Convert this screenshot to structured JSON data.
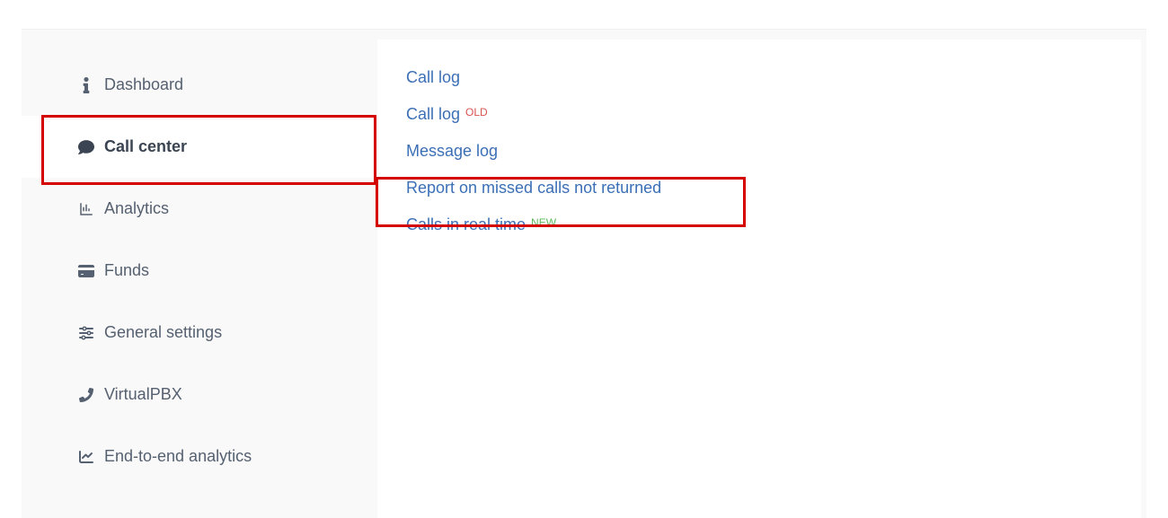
{
  "sidebar": {
    "items": [
      {
        "label": "Dashboard"
      },
      {
        "label": "Call center"
      },
      {
        "label": "Analytics"
      },
      {
        "label": "Funds"
      },
      {
        "label": "General settings"
      },
      {
        "label": "VirtualPBX"
      },
      {
        "label": "End-to-end analytics"
      }
    ]
  },
  "content": {
    "links": [
      {
        "label": "Call log"
      },
      {
        "label": "Call log",
        "badge": "OLD"
      },
      {
        "label": "Message log"
      },
      {
        "label": "Report on missed calls not returned"
      },
      {
        "label": "Calls in real time",
        "badge": "NEW"
      }
    ]
  }
}
